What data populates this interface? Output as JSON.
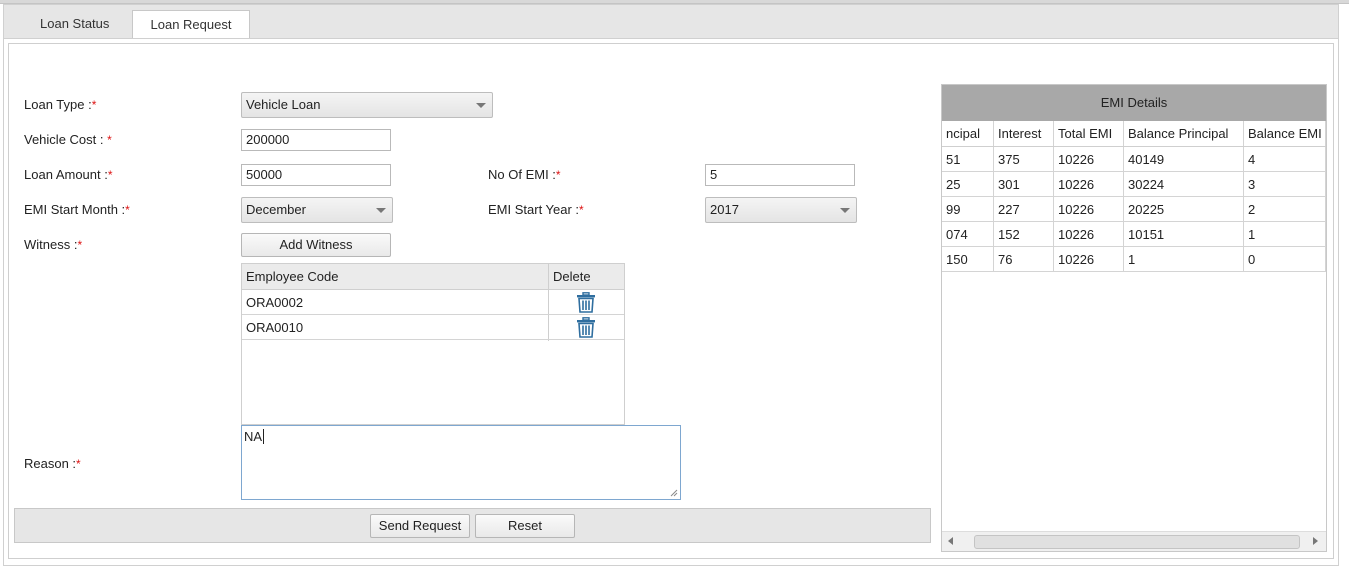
{
  "tabs": [
    {
      "label": "Loan Status",
      "active": false
    },
    {
      "label": "Loan Request",
      "active": true
    }
  ],
  "form": {
    "loan_type_label": "Loan Type :",
    "loan_type_value": "Vehicle Loan",
    "vehicle_cost_label": "Vehicle Cost : ",
    "vehicle_cost_value": "200000",
    "loan_amount_label": "Loan Amount :",
    "loan_amount_value": "50000",
    "no_of_emi_label": "No Of EMI :",
    "no_of_emi_value": "5",
    "emi_start_month_label": "EMI Start Month :",
    "emi_start_month_value": "December",
    "emi_start_year_label": "EMI Start Year :",
    "emi_start_year_value": "2017",
    "witness_label": "Witness :",
    "add_witness_button": "Add Witness",
    "reason_label": "Reason :",
    "reason_value": "NA",
    "required_mark": "*"
  },
  "witness_table": {
    "columns": [
      "Employee Code",
      "Delete"
    ],
    "rows": [
      {
        "code": "ORA0002",
        "delete_icon": "trash-icon"
      },
      {
        "code": "ORA0010",
        "delete_icon": "trash-icon"
      }
    ]
  },
  "actions": {
    "send_request": "Send Request",
    "reset": "Reset"
  },
  "emi_details": {
    "title": "EMI Details",
    "columns": [
      "ncipal",
      "Interest",
      "Total EMI",
      "Balance Principal",
      "Balance EMI"
    ],
    "rows": [
      [
        "51",
        "375",
        "10226",
        "40149",
        "4"
      ],
      [
        "25",
        "301",
        "10226",
        "30224",
        "3"
      ],
      [
        "99",
        "227",
        "10226",
        "20225",
        "2"
      ],
      [
        "074",
        "152",
        "10226",
        "10151",
        "1"
      ],
      [
        "150",
        "76",
        "10226",
        "1",
        "0"
      ]
    ]
  },
  "colors": {
    "tab_bar_bg": "#e6e6e6",
    "emi_header_bg": "#a8a8a8",
    "required_star": "#dd1111",
    "trash_icon": "#2f6e9f",
    "reason_border": "#7ea7d0"
  }
}
